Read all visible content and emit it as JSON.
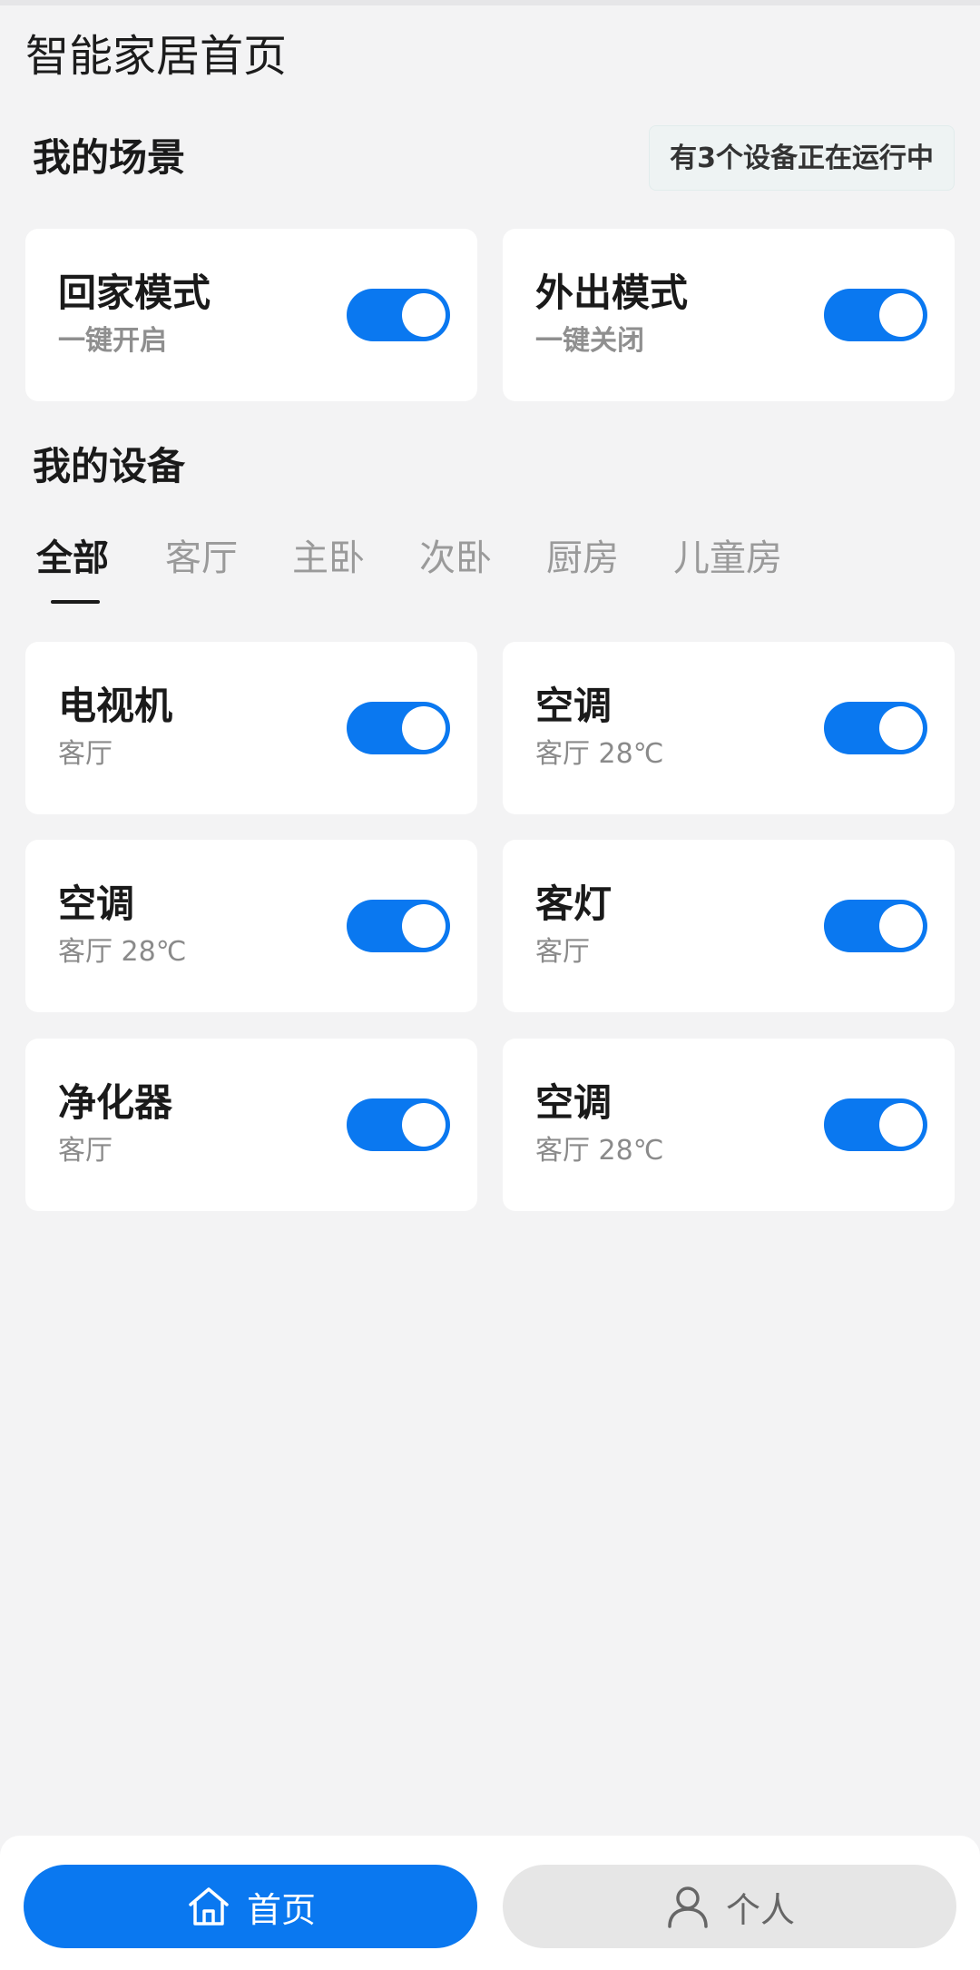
{
  "header": {
    "title": "智能家居首页"
  },
  "scenes": {
    "section_title": "我的场景",
    "running_badge": "有3个设备正在运行中",
    "items": [
      {
        "name": "回家模式",
        "subtitle": "一键开启",
        "on": true
      },
      {
        "name": "外出模式",
        "subtitle": "一键关闭",
        "on": true
      }
    ]
  },
  "devices": {
    "section_title": "我的设备",
    "tabs": [
      {
        "label": "全部",
        "active": true
      },
      {
        "label": "客厅",
        "active": false
      },
      {
        "label": "主卧",
        "active": false
      },
      {
        "label": "次卧",
        "active": false
      },
      {
        "label": "厨房",
        "active": false
      },
      {
        "label": "儿童房",
        "active": false
      }
    ],
    "items": [
      {
        "name": "电视机",
        "info": "客厅",
        "on": true
      },
      {
        "name": "空调",
        "info": "客厅 28℃",
        "on": true
      },
      {
        "name": "空调",
        "info": "客厅 28℃",
        "on": true
      },
      {
        "name": "客灯",
        "info": "客厅",
        "on": true
      },
      {
        "name": "净化器",
        "info": "客厅",
        "on": true
      },
      {
        "name": "空调",
        "info": "客厅 28℃",
        "on": true
      }
    ]
  },
  "bottom_nav": {
    "items": [
      {
        "label": "首页",
        "icon": "home-icon",
        "active": true
      },
      {
        "label": "个人",
        "icon": "person-icon",
        "active": false
      }
    ]
  },
  "colors": {
    "accent": "#0a78f0",
    "background": "#f3f3f4",
    "card": "#ffffff",
    "inactive_nav": "#e6e6e6"
  }
}
